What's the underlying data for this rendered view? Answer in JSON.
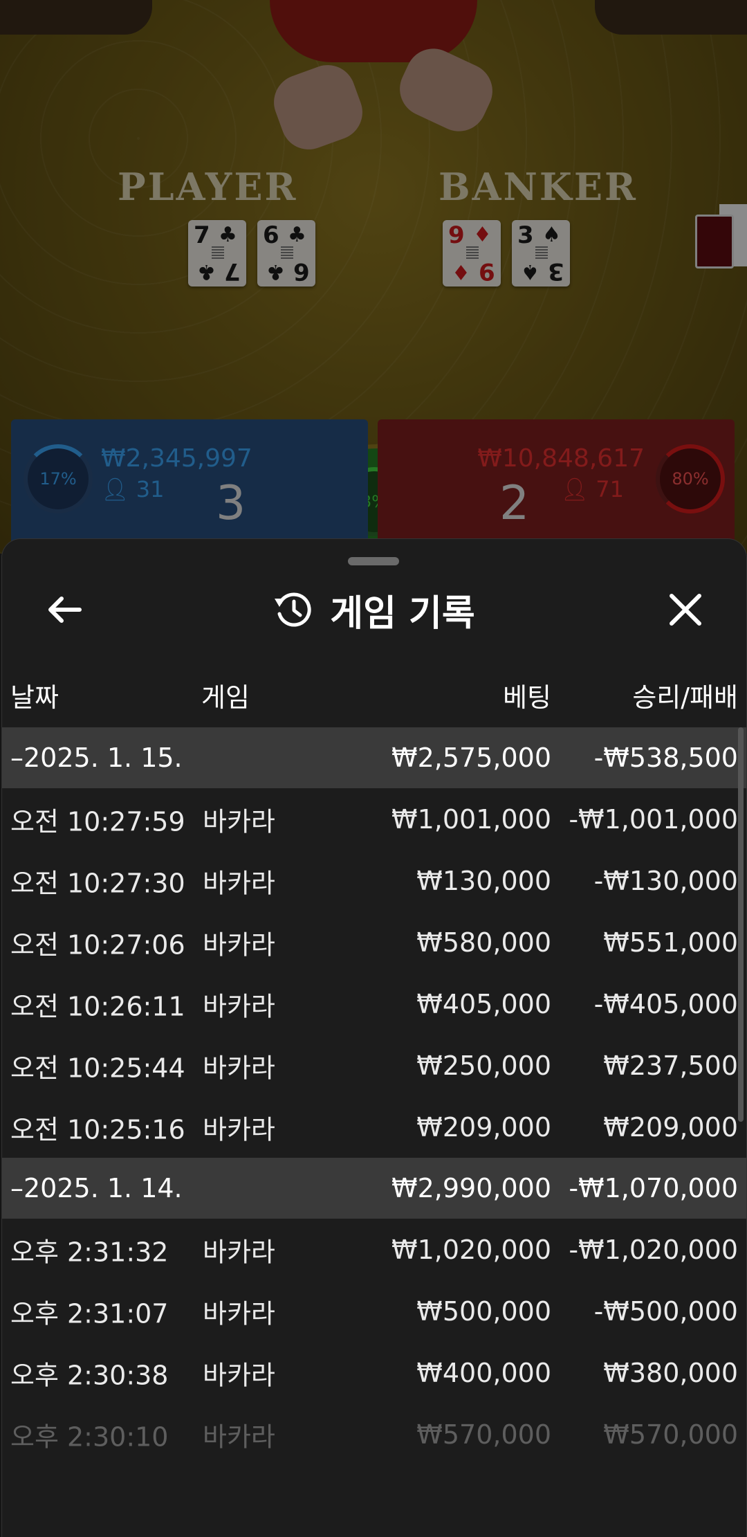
{
  "table": {
    "player_label": "PLAYER",
    "banker_label": "BANKER",
    "player_cards": [
      {
        "rank": "7",
        "suit": "♣",
        "color": "black"
      },
      {
        "rank": "6",
        "suit": "♣",
        "color": "black"
      }
    ],
    "banker_cards": [
      {
        "rank": "9",
        "suit": "♦",
        "color": "red"
      },
      {
        "rank": "3",
        "suit": "♠",
        "color": "black"
      }
    ],
    "player_panel": {
      "percent": "17%",
      "amount": "₩2,345,997",
      "count": "31",
      "score": "3"
    },
    "banker_panel": {
      "percent": "80%",
      "amount": "₩10,848,617",
      "count": "71",
      "score": "2"
    },
    "tie_percent": "3%"
  },
  "sheet": {
    "title": "게임 기록",
    "back_icon": "arrow-left-icon",
    "history_icon": "history-icon",
    "close_icon": "close-icon",
    "columns": {
      "date": "날짜",
      "game": "게임",
      "bet": "베팅",
      "result": "승리/패배"
    }
  },
  "groups": [
    {
      "date": "–2025. 1. 15.",
      "total_bet": "₩2,575,000",
      "total_result": "-₩538,500",
      "rows": [
        {
          "time": "오전 10:27:59",
          "game": "바카라",
          "bet": "₩1,001,000",
          "result": "-₩1,001,000"
        },
        {
          "time": "오전 10:27:30",
          "game": "바카라",
          "bet": "₩130,000",
          "result": "-₩130,000"
        },
        {
          "time": "오전 10:27:06",
          "game": "바카라",
          "bet": "₩580,000",
          "result": "₩551,000"
        },
        {
          "time": "오전 10:26:11",
          "game": "바카라",
          "bet": "₩405,000",
          "result": "-₩405,000"
        },
        {
          "time": "오전 10:25:44",
          "game": "바카라",
          "bet": "₩250,000",
          "result": "₩237,500"
        },
        {
          "time": "오전 10:25:16",
          "game": "바카라",
          "bet": "₩209,000",
          "result": "₩209,000"
        }
      ]
    },
    {
      "date": "–2025. 1. 14.",
      "total_bet": "₩2,990,000",
      "total_result": "-₩1,070,000",
      "rows": [
        {
          "time": "오후 2:31:32",
          "game": "바카라",
          "bet": "₩1,020,000",
          "result": "-₩1,020,000"
        },
        {
          "time": "오후 2:31:07",
          "game": "바카라",
          "bet": "₩500,000",
          "result": "-₩500,000"
        },
        {
          "time": "오후 2:30:38",
          "game": "바카라",
          "bet": "₩400,000",
          "result": "₩380,000"
        },
        {
          "time": "오후 2:30:10",
          "game": "바카라",
          "bet": "₩570,000",
          "result": "₩570,000"
        }
      ]
    }
  ]
}
